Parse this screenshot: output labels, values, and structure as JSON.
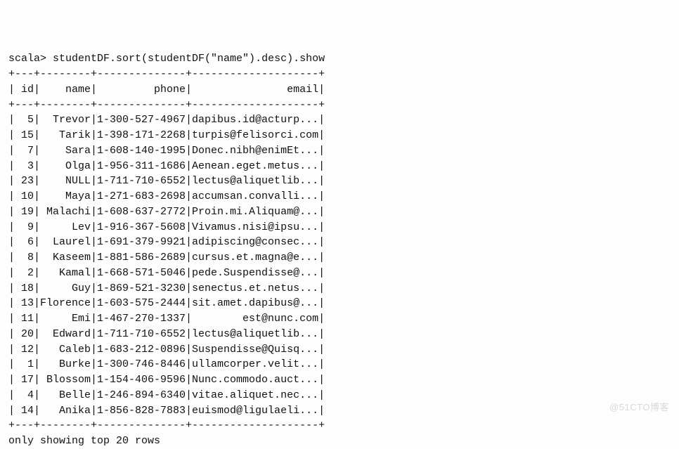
{
  "prompt": "scala> ",
  "command": "studentDF.sort(studentDF(\"name\").desc).show",
  "chart_data": {
    "type": "table",
    "columns": [
      "id",
      "name",
      "phone",
      "email"
    ],
    "rows": [
      {
        "id": "5",
        "name": "Trevor",
        "phone": "1-300-527-4967",
        "email": "dapibus.id@acturp..."
      },
      {
        "id": "15",
        "name": "Tarik",
        "phone": "1-398-171-2268",
        "email": "turpis@felisorci.com"
      },
      {
        "id": "7",
        "name": "Sara",
        "phone": "1-608-140-1995",
        "email": "Donec.nibh@enimEt..."
      },
      {
        "id": "3",
        "name": "Olga",
        "phone": "1-956-311-1686",
        "email": "Aenean.eget.metus..."
      },
      {
        "id": "23",
        "name": "NULL",
        "phone": "1-711-710-6552",
        "email": "lectus@aliquetlib..."
      },
      {
        "id": "10",
        "name": "Maya",
        "phone": "1-271-683-2698",
        "email": "accumsan.convalli..."
      },
      {
        "id": "19",
        "name": "Malachi",
        "phone": "1-608-637-2772",
        "email": "Proin.mi.Aliquam@..."
      },
      {
        "id": "9",
        "name": "Lev",
        "phone": "1-916-367-5608",
        "email": "Vivamus.nisi@ipsu..."
      },
      {
        "id": "6",
        "name": "Laurel",
        "phone": "1-691-379-9921",
        "email": "adipiscing@consec..."
      },
      {
        "id": "8",
        "name": "Kaseem",
        "phone": "1-881-586-2689",
        "email": "cursus.et.magna@e..."
      },
      {
        "id": "2",
        "name": "Kamal",
        "phone": "1-668-571-5046",
        "email": "pede.Suspendisse@..."
      },
      {
        "id": "18",
        "name": "Guy",
        "phone": "1-869-521-3230",
        "email": "senectus.et.netus..."
      },
      {
        "id": "13",
        "name": "Florence",
        "phone": "1-603-575-2444",
        "email": "sit.amet.dapibus@..."
      },
      {
        "id": "11",
        "name": "Emi",
        "phone": "1-467-270-1337",
        "email": "est@nunc.com"
      },
      {
        "id": "20",
        "name": "Edward",
        "phone": "1-711-710-6552",
        "email": "lectus@aliquetlib..."
      },
      {
        "id": "12",
        "name": "Caleb",
        "phone": "1-683-212-0896",
        "email": "Suspendisse@Quisq..."
      },
      {
        "id": "1",
        "name": "Burke",
        "phone": "1-300-746-8446",
        "email": "ullamcorper.velit..."
      },
      {
        "id": "17",
        "name": "Blossom",
        "phone": "1-154-406-9596",
        "email": "Nunc.commodo.auct..."
      },
      {
        "id": "4",
        "name": "Belle",
        "phone": "1-246-894-6340",
        "email": "vitae.aliquet.nec..."
      },
      {
        "id": "14",
        "name": "Anika",
        "phone": "1-856-828-7883",
        "email": "euismod@ligulaeli..."
      }
    ]
  },
  "footer": "only showing top 20 rows",
  "watermark": "@51CTO博客",
  "widths": {
    "id": 3,
    "name": 8,
    "phone": 14,
    "email": 20
  }
}
